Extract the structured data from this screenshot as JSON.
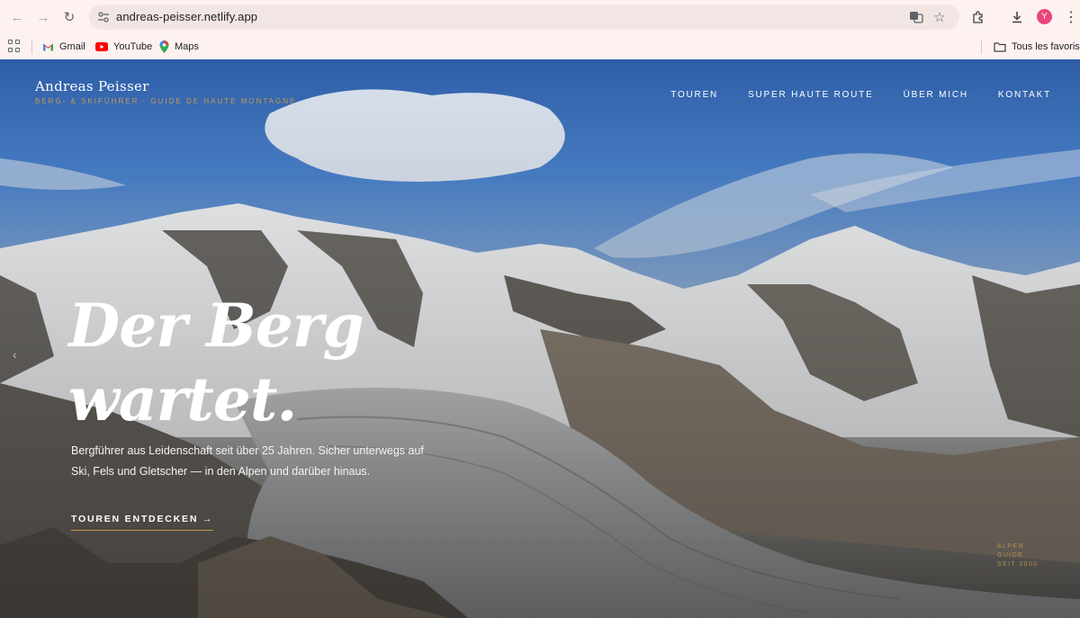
{
  "browser": {
    "url": "andreas-peisser.netlify.app",
    "avatar_letter": "Y",
    "icons": [
      "back-arrow-icon",
      "forward-arrow-icon",
      "reload-icon",
      "site-info-icon",
      "translate-icon",
      "star-icon",
      "extensions-icon",
      "download-icon",
      "kebab-menu-icon"
    ]
  },
  "bookmarks": {
    "items": [
      {
        "label": "Gmail",
        "icon": "gmail-icon"
      },
      {
        "label": "YouTube",
        "icon": "youtube-icon"
      },
      {
        "label": "Maps",
        "icon": "maps-icon"
      }
    ],
    "all_bookmarks": "Tous les favoris"
  },
  "site": {
    "brand_name": "Andreas Peisser",
    "brand_tagline": "BERG- & SKIFÜHRER · GUIDE DE HAUTE MONTAGNE",
    "nav": [
      "TOUREN",
      "SUPER HAUTE ROUTE",
      "ÜBER MICH",
      "KONTAKT"
    ],
    "hero": {
      "headline_line1": "Der Berg",
      "headline_line2": "wartet.",
      "subtext": "Bergführer aus Leidenschaft seit über 25 Jahren. Sicher unterwegs auf Ski, Fels und Gletscher — in den Alpen und darüber hinaus.",
      "cta": "TOUREN ENTDECKEN →"
    },
    "since_badge": [
      "ALPEN",
      "GUIDE",
      "SEIT 2000"
    ]
  },
  "colors": {
    "accent_gold": "#c49a52",
    "chrome_bg": "#fdf2ef",
    "omnibox_bg": "#f1e6e3"
  }
}
